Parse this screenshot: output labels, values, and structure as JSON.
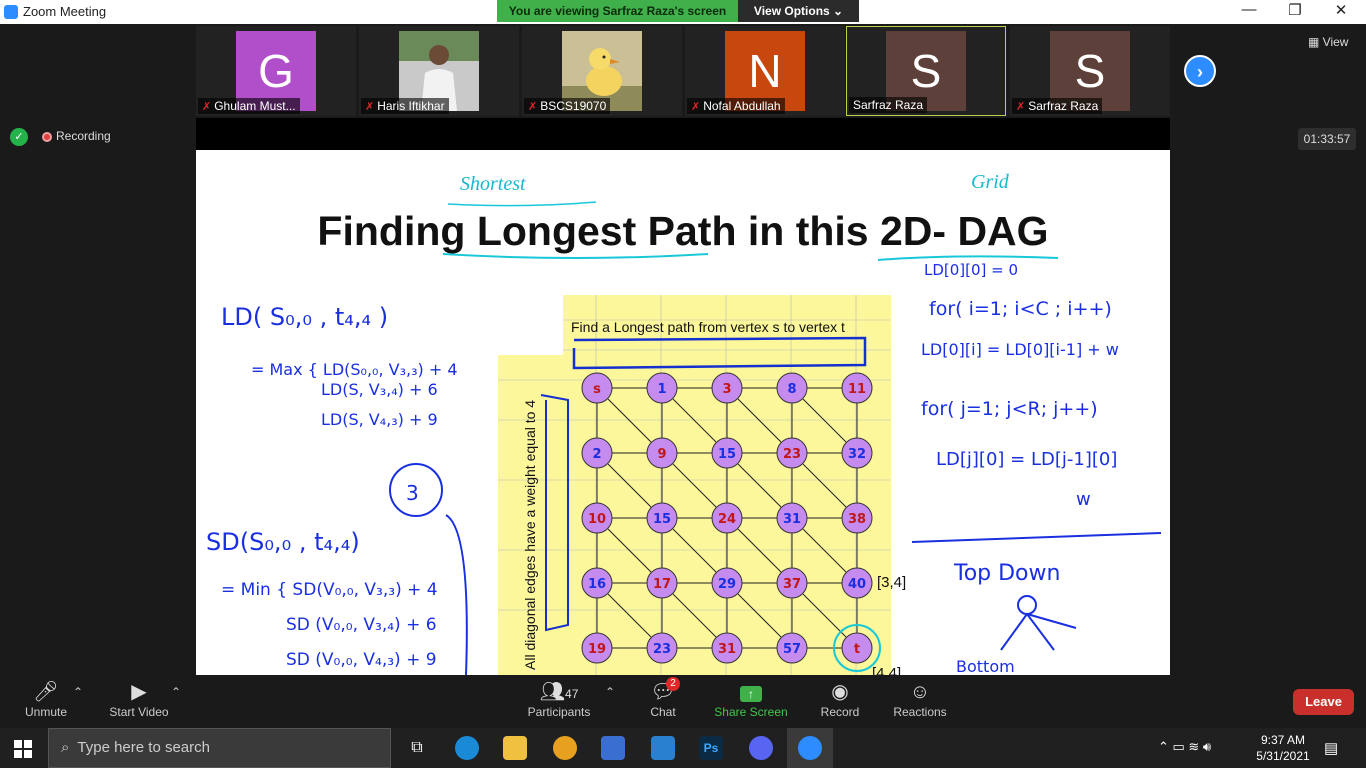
{
  "window": {
    "title": "Zoom Meeting",
    "min": "—",
    "restore": "❐",
    "close": "✕"
  },
  "banner": {
    "viewing": "You are viewing Sarfraz Raza's screen",
    "view_options": "View Options ⌄"
  },
  "participants": [
    {
      "name": "Ghulam Must...",
      "initial": "G",
      "color": "#b04fc9",
      "muted": true
    },
    {
      "name": "Haris Iftikhar",
      "initial": "",
      "color": "#8a8a8a",
      "muted": true
    },
    {
      "name": "BSCS19070",
      "initial": "",
      "color": "#a8a070",
      "muted": true
    },
    {
      "name": "Nofal Abdullah",
      "initial": "N",
      "color": "#c8470e",
      "muted": true
    },
    {
      "name": "Sarfraz Raza",
      "initial": "S",
      "color": "#5c4039",
      "muted": false
    },
    {
      "name": "Sarfraz Raza",
      "initial": "S",
      "color": "#5c4039",
      "muted": true
    }
  ],
  "view_label": "View",
  "recording_label": "Recording",
  "timer": "01:33:57",
  "slide": {
    "title": "Finding Longest Path in this 2D- DAG",
    "note_shortest": "Shortest",
    "note_grid": "Grid",
    "box_caption": "Find a Longest path from vertex s to vertex t",
    "side_caption": "All diagonal edges have a weight equal to 4",
    "label_34": "[3,4]",
    "label_44": "[4,4]",
    "left_notes": [
      "LD( S₀,₀ , t₄,₄ )",
      "= Max { LD(S₀,₀, V₃,₃) + 4",
      "LD(S, V₃,₄) + 6",
      "LD(S, V₄,₃) + 9",
      "SD(S₀,₀ , t₄,₄)",
      "= Min { SD(V₀,₀, V₃,₃) + 4",
      "SD (V₀,₀, V₃,₄) + 6",
      "SD (V₀,₀, V₄,₃) + 9"
    ],
    "right_notes": [
      "LD[0][0] = 0",
      "for( i=1; i<C ; i++)",
      "LD[0][i] = LD[0][i-1] + w",
      "for( j=1; j<R; j++)",
      "LD[j][0] = LD[j-1][0]",
      "w",
      "Top Down",
      "Bottom"
    ],
    "nodes": [
      "s",
      "1",
      "3",
      "8",
      "11",
      "2",
      "9",
      "15",
      "23",
      "32",
      "10",
      "15",
      "24",
      "31",
      "38",
      "16",
      "17",
      "29",
      "37",
      "40",
      "19",
      "23",
      "31",
      "57",
      "t"
    ]
  },
  "toolbar": {
    "unmute": "Unmute",
    "start_video": "Start Video",
    "participants_count": "47",
    "participants": "Participants",
    "chat": "Chat",
    "chat_badge": "2",
    "share_screen": "Share Screen",
    "record": "Record",
    "reactions": "Reactions",
    "leave": "Leave"
  },
  "taskbar": {
    "search_placeholder": "Type here to search",
    "time": "9:37 AM",
    "date": "5/31/2021"
  }
}
